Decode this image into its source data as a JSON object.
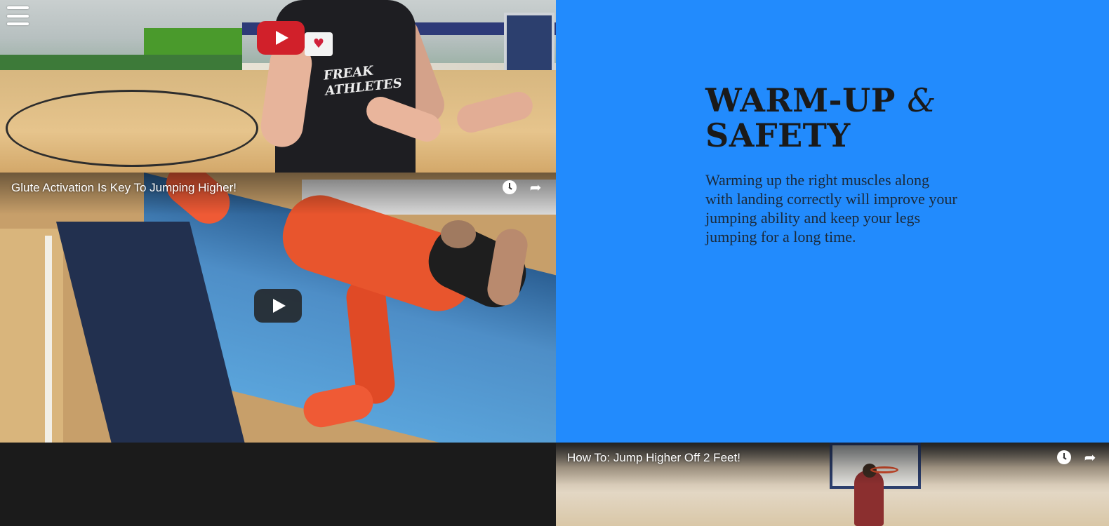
{
  "menu": {
    "icon": "hamburger-menu-icon"
  },
  "videos": [
    {
      "title": "",
      "play_button": "youtube-red-play-icon",
      "shirt_text_line1": "FREAK",
      "shirt_text_line2": "ATHLETES",
      "badge": "♥"
    },
    {
      "title": "Glute Activation Is Key To Jumping Higher!",
      "icons": [
        "watch-later-icon",
        "share-icon"
      ],
      "play_button": "dark-play-icon"
    },
    {
      "title": "How To: Jump Higher Off 2 Feet!",
      "icons": [
        "watch-later-icon",
        "share-icon"
      ]
    }
  ],
  "panel": {
    "heading_main": "WARM-UP",
    "heading_amp": "&",
    "heading_second": "SAFETY",
    "description": "Warming up the right muscles along with landing correctly will improve your jumping ability and keep your legs jumping for a long time.",
    "background_color": "#228bfd",
    "text_color": "#1a1a1a"
  },
  "icons": {
    "share_glyph": "➦"
  }
}
